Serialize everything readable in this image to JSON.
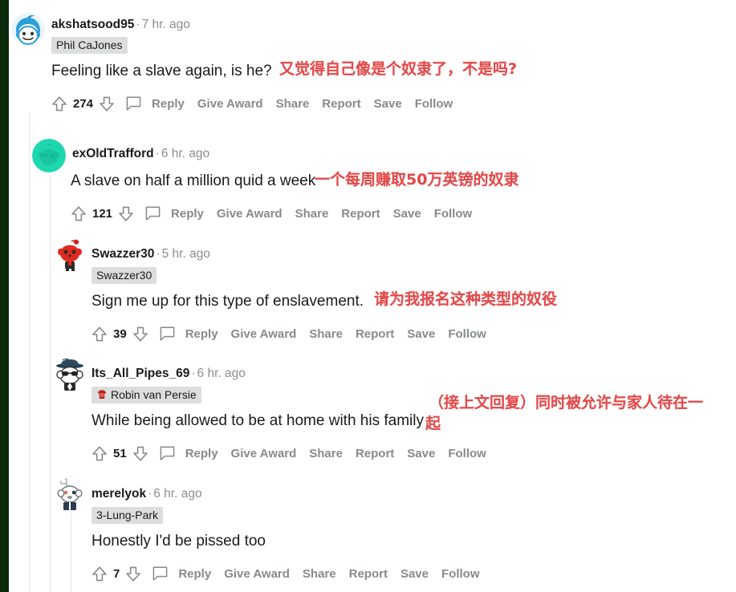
{
  "page": {
    "site": "reddit-comment-thread",
    "accent_translation_color": "#e24a4a",
    "left_edge_color": "#0b2a0c"
  },
  "action_labels": {
    "reply": "Reply",
    "give_award": "Give Award",
    "share": "Share",
    "report": "Report",
    "save": "Save",
    "follow": "Follow"
  },
  "comments": [
    {
      "username": "akshatsood95",
      "separator": "·",
      "age": "7 hr. ago",
      "flair": "Phil CaJones",
      "flair_icon": "none",
      "text": "Feeling like a slave again, is he?",
      "translation": "又觉得自己像是个奴隶了，不是吗?",
      "translation_line2": "",
      "score": "274",
      "avatar": "snoo-blue-hair"
    },
    {
      "username": "exOldTrafford",
      "separator": "·",
      "age": "6 hr. ago",
      "flair": "",
      "flair_icon": "none",
      "text": "A slave on half a million quid a week",
      "translation": "一个每周赚取50万英镑的奴隶",
      "translation_line2": "",
      "score": "121",
      "avatar": "snoo-teal"
    },
    {
      "username": "Swazzer30",
      "separator": "·",
      "age": "5 hr. ago",
      "flair": "Swazzer30",
      "flair_icon": "none",
      "text": "Sign me up for this type of enslavement.",
      "translation": "请为我报名这种类型的奴役",
      "translation_line2": "",
      "score": "39",
      "avatar": "snoo-red"
    },
    {
      "username": "Its_All_Pipes_69",
      "separator": "·",
      "age": "6 hr. ago",
      "flair": "Robin van Persie",
      "flair_icon": "red-jersey-20",
      "text": "While being allowed to be at home with his family",
      "translation": "（接上文回复）同时被允许与家人待在一",
      "translation_line2": "起",
      "score": "51",
      "avatar": "snoo-hat-sunglasses"
    },
    {
      "username": "merelyok",
      "separator": "·",
      "age": "6 hr. ago",
      "flair": "3-Lung-Park",
      "flair_icon": "none",
      "text": "Honestly I'd be pissed too",
      "translation": "",
      "translation_line2": "",
      "score": "7",
      "avatar": "snoo-grey"
    }
  ]
}
